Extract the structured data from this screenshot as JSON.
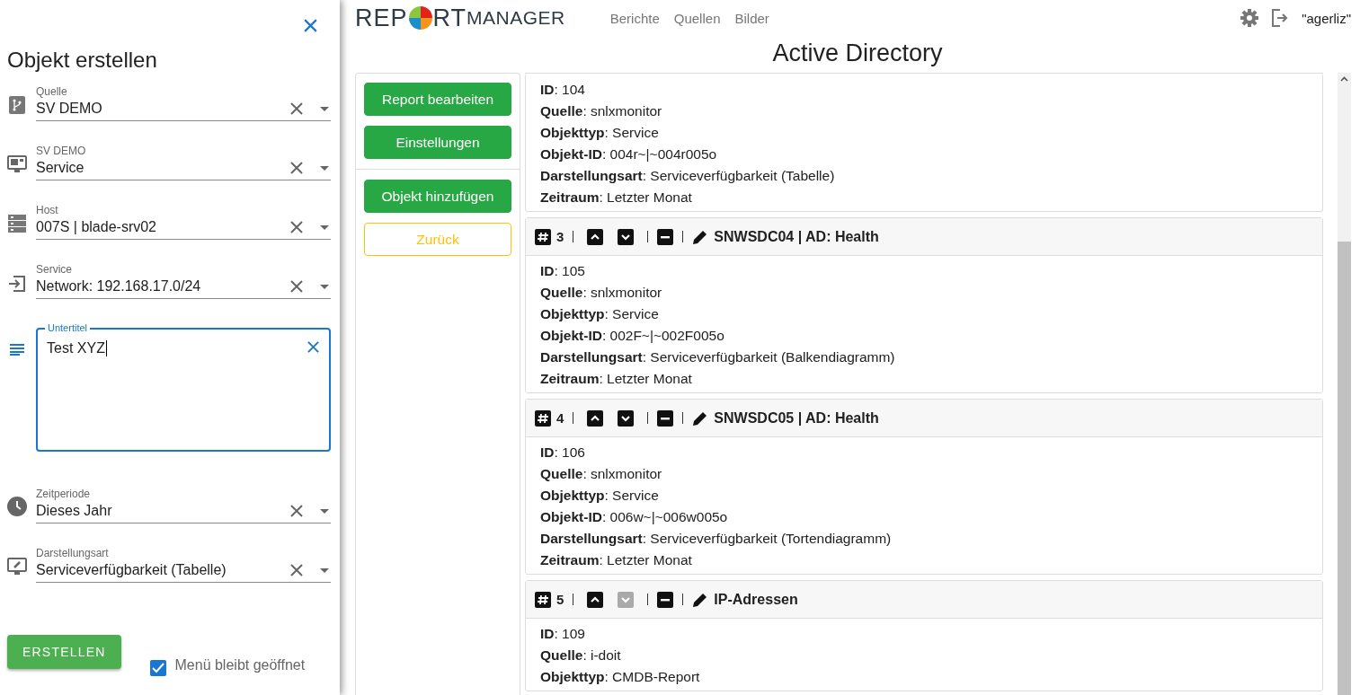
{
  "drawer": {
    "title": "Objekt erstellen",
    "fields": [
      {
        "kind": "select",
        "label": "Quelle",
        "value": "SV DEMO"
      },
      {
        "kind": "select",
        "label": "SV DEMO",
        "value": "Service"
      },
      {
        "kind": "select",
        "label": "Host",
        "value": "007S | blade-srv02"
      },
      {
        "kind": "select",
        "label": "Service",
        "value": "Network: 192.168.17.0/24"
      },
      {
        "kind": "textarea",
        "label": "Untertitel",
        "value": "Test XYZ",
        "focused": true
      },
      {
        "kind": "select",
        "label": "Zeitperiode",
        "value": "Dieses Jahr"
      },
      {
        "kind": "select",
        "label": "Darstellungsart",
        "value": "Serviceverfügbarkeit (Tabelle)"
      }
    ],
    "submit": "ERSTELLEN",
    "keep_open": {
      "label": "Menü bleibt geöffnet",
      "checked": true
    }
  },
  "header": {
    "logo": {
      "before": "REP",
      "after": "RT",
      "suffix": "MANAGER"
    },
    "nav": [
      "Berichte",
      "Quellen",
      "Bilder"
    ],
    "user": "\"agerliz\""
  },
  "page_title": "Active Directory",
  "actions": [
    {
      "kind": "primary",
      "label": "Report bearbeiten"
    },
    {
      "kind": "primary",
      "label": "Einstellungen"
    },
    {
      "kind": "divider"
    },
    {
      "kind": "primary",
      "label": "Objekt hinzufügen"
    },
    {
      "kind": "outline",
      "label": "Zurück"
    }
  ],
  "cards": [
    {
      "lines": [
        "**ID**: 104",
        "**Quelle**: snlxmonitor",
        "**Objekttyp**: Service",
        "**Objekt-ID**: 004r~|~004r005o",
        "**Darstellungsart**: Serviceverfügbarkeit (Tabelle)",
        "**Zeitraum**: Letzter Monat"
      ]
    },
    {
      "number": "3",
      "up_enabled": true,
      "down_enabled": true,
      "title": "SNWSDC04 | AD: Health",
      "lines": [
        "**ID**: 105",
        "**Quelle**: snlxmonitor",
        "**Objekttyp**: Service",
        "**Objekt-ID**: 002F~|~002F005o",
        "**Darstellungsart**: Serviceverfügbarkeit (Balkendiagramm)",
        "**Zeitraum**: Letzter Monat"
      ]
    },
    {
      "number": "4",
      "up_enabled": true,
      "down_enabled": true,
      "title": "SNWSDC05 | AD: Health",
      "lines": [
        "**ID**: 106",
        "**Quelle**: snlxmonitor",
        "**Objekttyp**: Service",
        "**Objekt-ID**: 006w~|~006w005o",
        "**Darstellungsart**: Serviceverfügbarkeit (Tortendiagramm)",
        "**Zeitraum**: Letzter Monat"
      ]
    },
    {
      "number": "5",
      "up_enabled": true,
      "down_enabled": false,
      "title": "IP-Adressen",
      "lines": [
        "**ID**: 109",
        "**Quelle**: i-doit",
        "**Objekttyp**: CMDB-Report"
      ]
    }
  ]
}
